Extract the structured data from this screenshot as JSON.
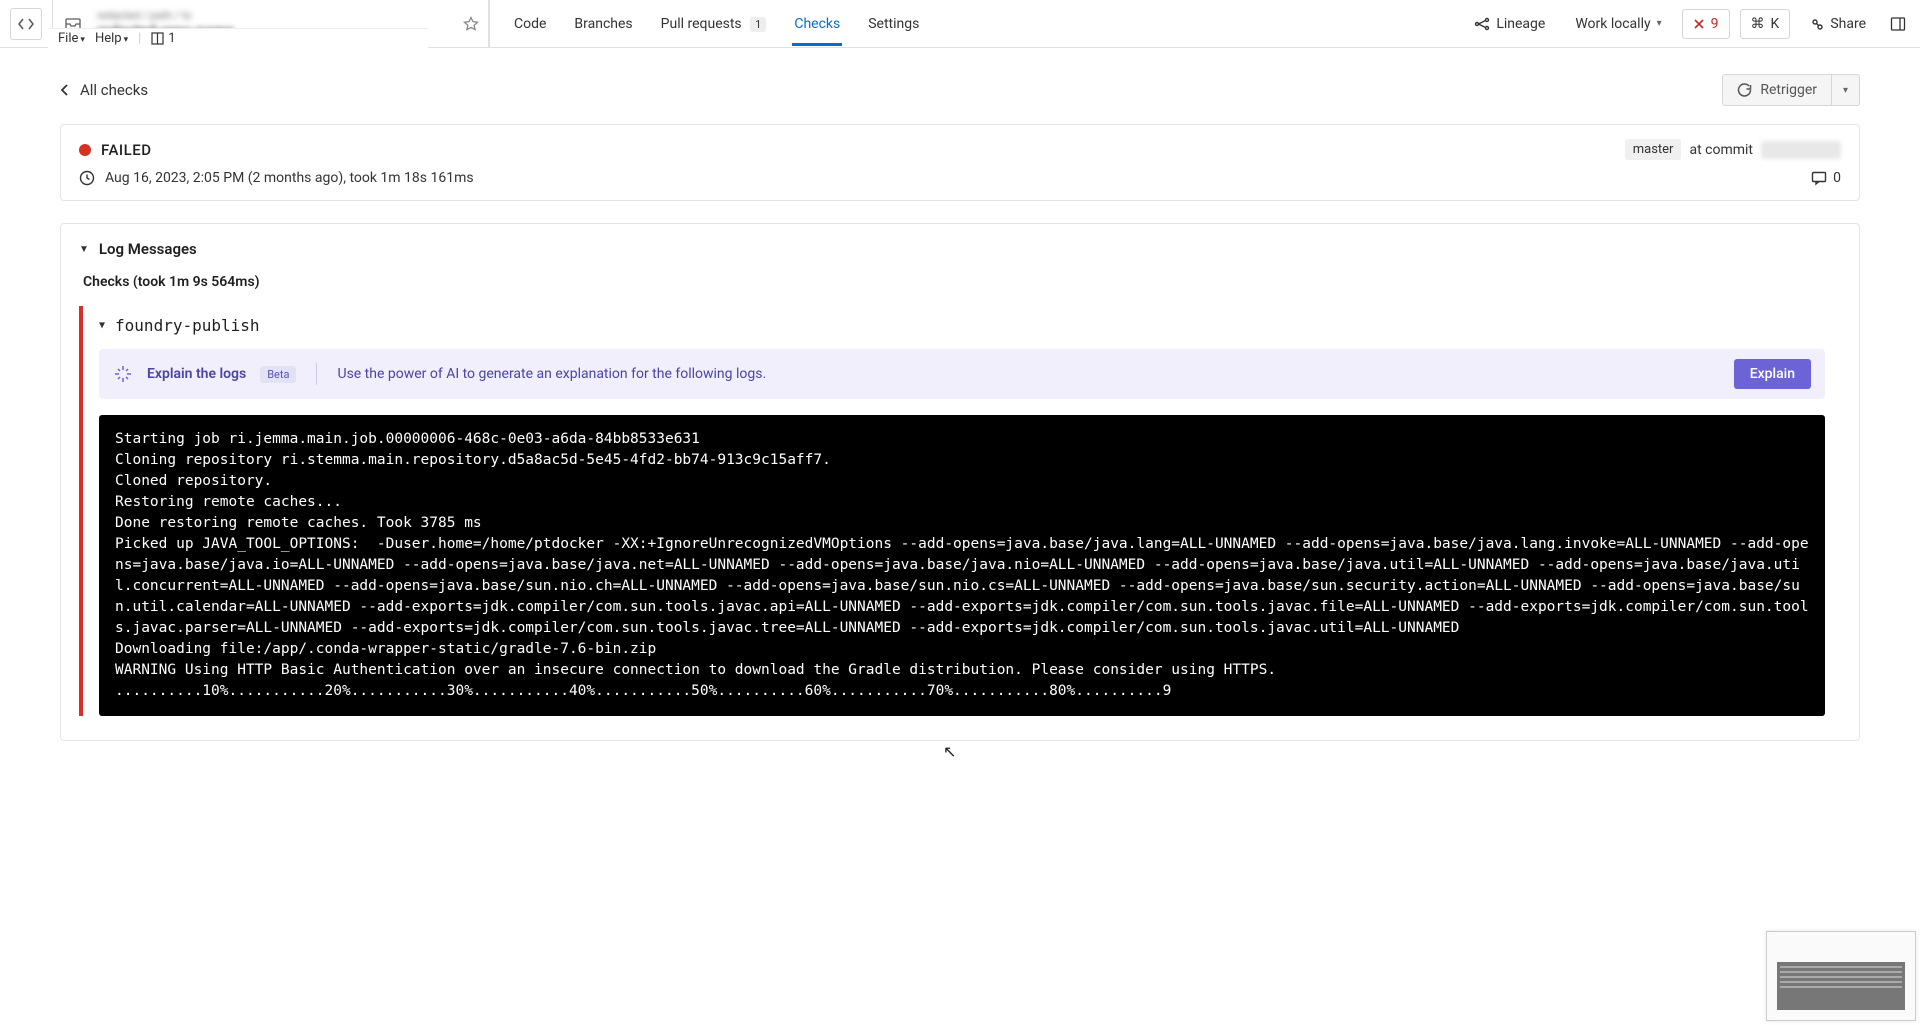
{
  "menus": {
    "file": "File",
    "help": "Help",
    "panel_count": "1"
  },
  "breadcrumb": {
    "path": "redacted / path / to",
    "title": "redacted-repo-name"
  },
  "tabs": {
    "code": "Code",
    "branches": "Branches",
    "pull_requests": "Pull requests",
    "pr_count": "1",
    "checks": "Checks",
    "settings": "Settings"
  },
  "toolbar": {
    "lineage": "Lineage",
    "work_locally": "Work locally",
    "error_count": "9",
    "cmd_key": "K",
    "share": "Share"
  },
  "back": {
    "label": "All checks"
  },
  "retrigger": {
    "label": "Retrigger"
  },
  "status": {
    "state": "FAILED",
    "branch": "master",
    "at_commit": "at commit",
    "timestamp": "Aug 16, 2023, 2:05 PM (2 months ago), took 1m 18s 161ms",
    "comment_count": "0"
  },
  "logs": {
    "section_title": "Log Messages",
    "checks_timing": "Checks (took 1m 9s 564ms)",
    "task_name": "foundry-publish"
  },
  "explain": {
    "title": "Explain the logs",
    "beta": "Beta",
    "desc": "Use the power of AI to generate an explanation for the following logs.",
    "button": "Explain"
  },
  "terminal_lines": [
    "Starting job ri.jemma.main.job.00000006-468c-0e03-a6da-84bb8533e631",
    "Cloning repository ri.stemma.main.repository.d5a8ac5d-5e45-4fd2-bb74-913c9c15aff7.",
    "Cloned repository.",
    "Restoring remote caches...",
    "Done restoring remote caches. Took 3785 ms",
    "Picked up JAVA_TOOL_OPTIONS:  -Duser.home=/home/ptdocker -XX:+IgnoreUnrecognizedVMOptions --add-opens=java.base/java.lang=ALL-UNNAMED --add-opens=java.base/java.lang.invoke=ALL-UNNAMED --add-opens=java.base/java.io=ALL-UNNAMED --add-opens=java.base/java.net=ALL-UNNAMED --add-opens=java.base/java.nio=ALL-UNNAMED --add-opens=java.base/java.util=ALL-UNNAMED --add-opens=java.base/java.util.concurrent=ALL-UNNAMED --add-opens=java.base/sun.nio.ch=ALL-UNNAMED --add-opens=java.base/sun.nio.cs=ALL-UNNAMED --add-opens=java.base/sun.security.action=ALL-UNNAMED --add-opens=java.base/sun.util.calendar=ALL-UNNAMED --add-exports=jdk.compiler/com.sun.tools.javac.api=ALL-UNNAMED --add-exports=jdk.compiler/com.sun.tools.javac.file=ALL-UNNAMED --add-exports=jdk.compiler/com.sun.tools.javac.parser=ALL-UNNAMED --add-exports=jdk.compiler/com.sun.tools.javac.tree=ALL-UNNAMED --add-exports=jdk.compiler/com.sun.tools.javac.util=ALL-UNNAMED",
    "Downloading file:/app/.conda-wrapper-static/gradle-7.6-bin.zip",
    "WARNING Using HTTP Basic Authentication over an insecure connection to download the Gradle distribution. Please consider using HTTPS.",
    "..........10%...........20%...........30%...........40%...........50%..........60%...........70%...........80%..........9"
  ]
}
